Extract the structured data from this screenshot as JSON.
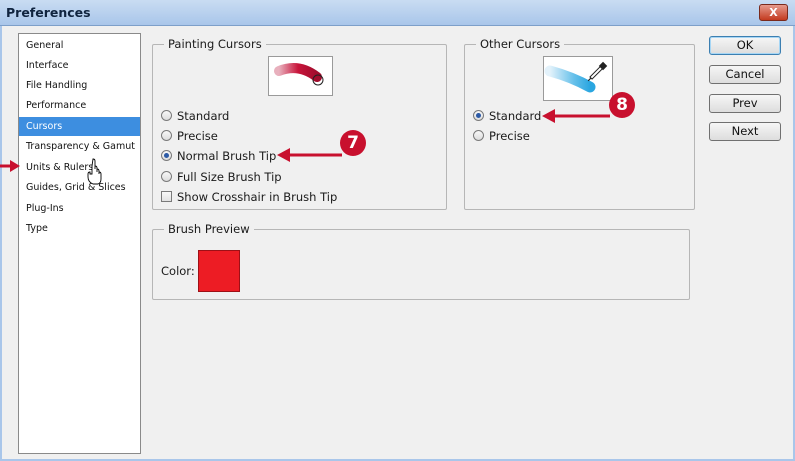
{
  "window": {
    "title": "Preferences",
    "close_label": "X"
  },
  "sidebar": {
    "items": [
      {
        "label": "General",
        "selected": false
      },
      {
        "label": "Interface",
        "selected": false
      },
      {
        "label": "File Handling",
        "selected": false
      },
      {
        "label": "Performance",
        "selected": false
      },
      {
        "label": "Cursors",
        "selected": true
      },
      {
        "label": "Transparency & Gamut",
        "selected": false
      },
      {
        "label": "Units & Rulers",
        "selected": false
      },
      {
        "label": "Guides, Grid & Slices",
        "selected": false
      },
      {
        "label": "Plug-Ins",
        "selected": false
      },
      {
        "label": "Type",
        "selected": false
      }
    ]
  },
  "painting_cursors": {
    "title": "Painting Cursors",
    "options": [
      {
        "label": "Standard",
        "checked": false
      },
      {
        "label": "Precise",
        "checked": false
      },
      {
        "label": "Normal Brush Tip",
        "checked": true
      },
      {
        "label": "Full Size Brush Tip",
        "checked": false
      }
    ],
    "crosshair_label": "Show Crosshair in Brush Tip",
    "crosshair_checked": false
  },
  "other_cursors": {
    "title": "Other Cursors",
    "options": [
      {
        "label": "Standard",
        "checked": true
      },
      {
        "label": "Precise",
        "checked": false
      }
    ]
  },
  "brush_preview": {
    "title": "Brush Preview",
    "color_label": "Color:",
    "color": "#ed1c24"
  },
  "buttons": {
    "ok": "OK",
    "cancel": "Cancel",
    "prev": "Prev",
    "next": "Next"
  },
  "callouts": {
    "step7": "7",
    "step8": "8",
    "color": "#c8102e"
  }
}
